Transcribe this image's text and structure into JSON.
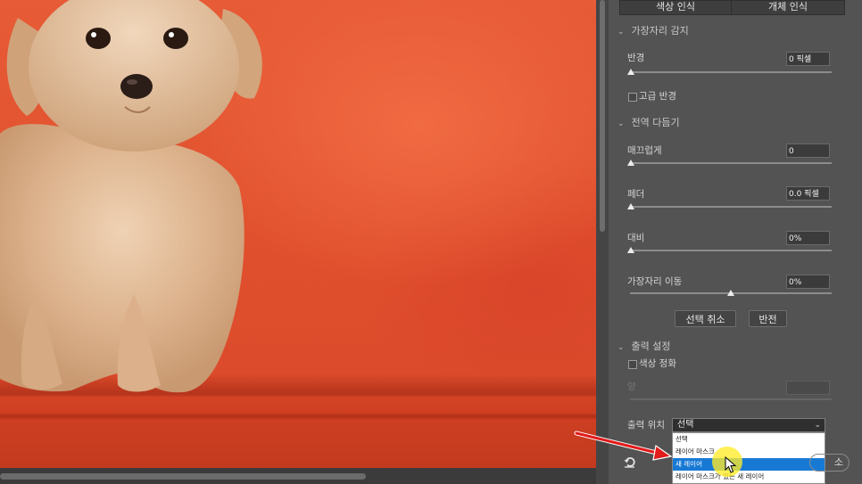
{
  "tabs": [
    "색상 인식",
    "개체 인식"
  ],
  "edge_detection": {
    "title": "가장자리 감지",
    "radius_label": "반경",
    "radius_value": "0 픽셀",
    "radius_level": 0.0,
    "smart_radius_label": "고급 반경",
    "smart_radius_checked": false
  },
  "global_refinements": {
    "title": "전역 다듬기",
    "smooth_label": "매끄럽게",
    "smooth_value": "0",
    "smooth_level": 0.0,
    "feather_label": "페더",
    "feather_value": "0.0 픽셀",
    "feather_level": 0.0,
    "contrast_label": "대비",
    "contrast_value": "0%",
    "contrast_level": 0.0,
    "shift_edge_label": "가장자리 이동",
    "shift_edge_value": "0%",
    "shift_edge_level": 0.5,
    "clear_selection_label": "선택 취소",
    "invert_label": "반전"
  },
  "output_settings": {
    "title": "출력 설정",
    "decontaminate_label": "색상 정화",
    "decontaminate_checked": false,
    "amount_label": "양",
    "output_to_label": "출력 위치",
    "output_to_value": "선택",
    "options": [
      "선택",
      "레이어 마스크",
      "새 레이어",
      "레이어 마스크가 있는 새 레이어"
    ],
    "highlighted_option": "새 레이어"
  },
  "footer": {
    "ok_partial": "소"
  },
  "icons": {
    "reset": "reset-icon",
    "section_toggle": "chevron-down-icon",
    "pointer": "cursor-arrow-icon",
    "annotation": "red-arrow-icon"
  },
  "colors": {
    "panel_bg": "#535353",
    "highlight": "#1779d4",
    "background_red": "#e04f2d",
    "annotation_red": "#e21b1b",
    "cursor_highlight": "#ffec28"
  }
}
